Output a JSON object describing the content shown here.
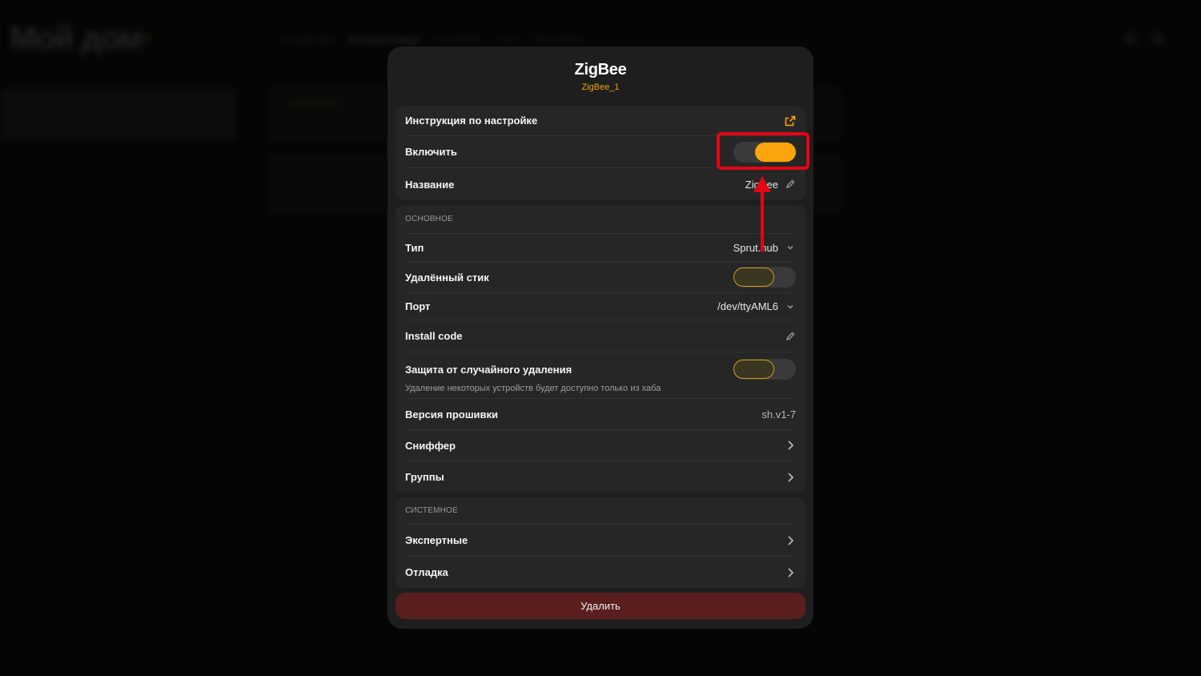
{
  "background": {
    "app_title": "Мой дом",
    "nav": [
      "Устройства",
      "Контроллеры",
      "Сценарии",
      "Логи",
      "Настройки"
    ],
    "active_nav_index": 1
  },
  "modal": {
    "title": "ZigBee",
    "subtitle": "ZigBee_1",
    "top_group": {
      "instructions_label": "Инструкция по настройке",
      "enable_label": "Включить",
      "enable_on": true,
      "name_label": "Название",
      "name_value": "ZigBee"
    },
    "main_group": {
      "section_title": "ОСНОВНОЕ",
      "type_label": "Тип",
      "type_value": "Sprut.hub",
      "remote_stick_label": "Удалённый стик",
      "remote_stick_on": false,
      "port_label": "Порт",
      "port_value": "/dev/ttyAML6",
      "install_code_label": "Install code",
      "protection_label": "Защита от случайного удаления",
      "protection_on": false,
      "protection_hint": "Удаление некоторых устройств будет доступно только из хаба",
      "firmware_label": "Версия прошивки",
      "firmware_value": "sh.v1-7",
      "sniffer_label": "Сниффер",
      "groups_label": "Группы"
    },
    "system_group": {
      "section_title": "СИСТЕМНОЕ",
      "expert_label": "Экспертные",
      "debug_label": "Отладка"
    },
    "delete_label": "Удалить"
  },
  "colors": {
    "accent": "#fba40b",
    "annotation": "#e30613",
    "danger_button": "#5a1e1e"
  }
}
